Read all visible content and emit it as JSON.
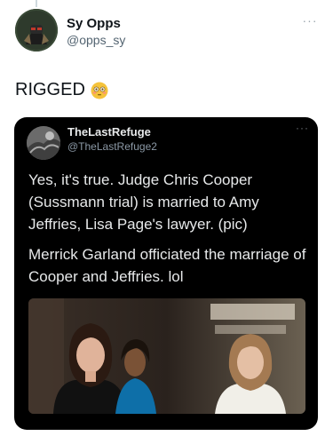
{
  "tweet": {
    "display_name": "Sy Opps",
    "handle": "@opps_sy",
    "more_label": "···",
    "text": "RIGGED",
    "emoji": "flushed-face-emoji"
  },
  "quote": {
    "display_name": "TheLastRefuge",
    "handle": "@TheLastRefuge2",
    "more_label": "···",
    "paragraph_1": "Yes, it's true.  Judge Chris Cooper (Sussmann trial) is married to Amy Jeffries, Lisa Page's lawyer. (pic)",
    "paragraph_2": "Merrick Garland officiated the marriage of Cooper and Jeffries. lol"
  },
  "colors": {
    "quote_background": "#000000",
    "name_text": "#0f1419",
    "handle_text": "#536471"
  }
}
